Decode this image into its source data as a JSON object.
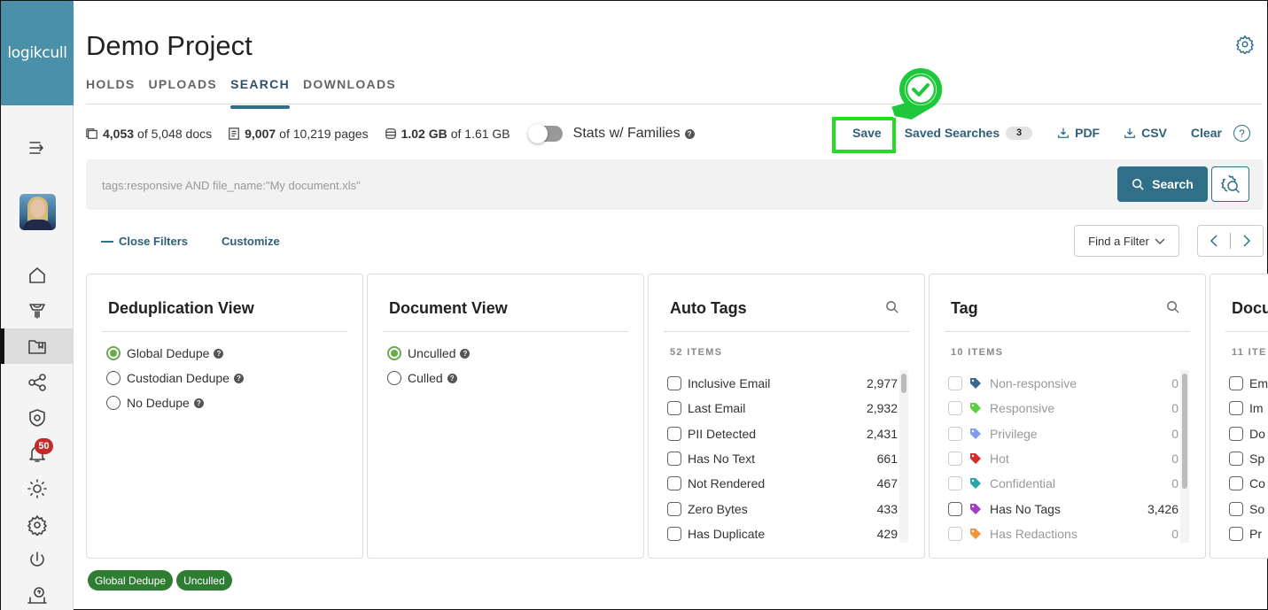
{
  "app": {
    "logo": "logikcull"
  },
  "sidebar": {
    "items": [
      {
        "name": "collapse-menu",
        "icon": "menu-collapse-icon"
      },
      {
        "name": "home",
        "icon": "home-icon"
      },
      {
        "name": "uploads",
        "icon": "upload-rocket-icon"
      },
      {
        "name": "projects",
        "icon": "folder-bookmark-icon",
        "active": true
      },
      {
        "name": "share",
        "icon": "share-icon"
      },
      {
        "name": "security",
        "icon": "shield-gear-icon"
      },
      {
        "name": "notifications",
        "icon": "bell-icon",
        "badge": "50"
      },
      {
        "name": "theme",
        "icon": "sun-icon"
      },
      {
        "name": "settings",
        "icon": "gear-icon"
      },
      {
        "name": "logout",
        "icon": "power-icon"
      },
      {
        "name": "support",
        "icon": "help-laptop-icon"
      }
    ]
  },
  "header": {
    "title": "Demo Project",
    "tabs": [
      {
        "label": "HOLDS"
      },
      {
        "label": "UPLOADS"
      },
      {
        "label": "SEARCH",
        "active": true
      },
      {
        "label": "DOWNLOADS"
      }
    ]
  },
  "stats": {
    "docs_bold": "4,053",
    "docs_rest": "of 5,048 docs",
    "pages_bold": "9,007",
    "pages_rest": "of 10,219 pages",
    "size_bold": "1.02 GB",
    "size_rest": "of 1.61 GB",
    "families_label": "Stats w/ Families",
    "families_on": false
  },
  "actions": {
    "save": "Save",
    "saved_searches": "Saved Searches",
    "saved_count": "3",
    "pdf": "PDF",
    "csv": "CSV",
    "clear": "Clear",
    "help": "?"
  },
  "search": {
    "placeholder": "tags:responsive AND file_name:\"My document.xls\"",
    "value": "",
    "button": "Search"
  },
  "filters": {
    "close_filters": "Close Filters",
    "customize": "Customize",
    "find_filter": "Find a Filter"
  },
  "cards": {
    "dedup": {
      "title": "Deduplication View",
      "options": [
        {
          "label": "Global Dedupe",
          "selected": true
        },
        {
          "label": "Custodian Dedupe",
          "selected": false
        },
        {
          "label": "No Dedupe",
          "selected": false
        }
      ]
    },
    "docview": {
      "title": "Document View",
      "options": [
        {
          "label": "Unculled",
          "selected": true
        },
        {
          "label": "Culled",
          "selected": false
        }
      ]
    },
    "autotags": {
      "title": "Auto Tags",
      "count": "52 ITEMS",
      "items": [
        {
          "label": "Inclusive Email",
          "count": "2,977"
        },
        {
          "label": "Last Email",
          "count": "2,932"
        },
        {
          "label": "PII Detected",
          "count": "2,431"
        },
        {
          "label": "Has No Text",
          "count": "661"
        },
        {
          "label": "Not Rendered",
          "count": "467"
        },
        {
          "label": "Zero Bytes",
          "count": "433"
        },
        {
          "label": "Has Duplicate",
          "count": "429"
        }
      ]
    },
    "tag": {
      "title": "Tag",
      "count": "10 ITEMS",
      "items": [
        {
          "label": "Non-responsive",
          "count": "0",
          "color": "#3d6591",
          "dim": true
        },
        {
          "label": "Responsive",
          "count": "0",
          "color": "#5ccf3c",
          "dim": true
        },
        {
          "label": "Privilege",
          "count": "0",
          "color": "#7f9ef0",
          "dim": true
        },
        {
          "label": "Hot",
          "count": "0",
          "color": "#d62c2c",
          "dim": true
        },
        {
          "label": "Confidential",
          "count": "0",
          "color": "#2aa6a6",
          "dim": true
        },
        {
          "label": "Has No Tags",
          "count": "3,426",
          "color": "#a23cc9",
          "dim": false
        },
        {
          "label": "Has Redactions",
          "count": "0",
          "color": "#f0953a",
          "dim": true
        }
      ]
    },
    "doctype": {
      "title": "Docu",
      "count": "11 ITE",
      "items": [
        "Em",
        "Im",
        "Do",
        "Sp",
        "Co",
        "So",
        "Pr"
      ]
    }
  },
  "active_chips": [
    "Global Dedupe",
    "Unculled"
  ],
  "colors": {
    "brand": "#4a90a8",
    "accent": "#2f6f88",
    "selected_radio": "#6aab4f",
    "chip": "#2e7d32",
    "highlight": "#22dd22",
    "badge": "#c62828"
  }
}
